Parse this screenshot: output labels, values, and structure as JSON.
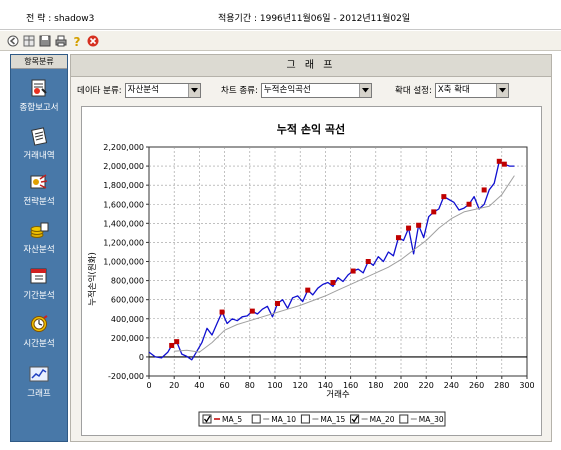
{
  "header": {
    "strategy": "전 략 : shadow3",
    "period": "적용기간 : 1996년11월06일 - 2012년11월02일"
  },
  "toolbar": {
    "buttons": [
      "back-icon",
      "grid-icon",
      "save-icon",
      "print-icon",
      "help-icon",
      "close-icon"
    ]
  },
  "sidebar": {
    "title": "항목분류",
    "items": [
      {
        "label": "종합보고서",
        "icon": "report-icon"
      },
      {
        "label": "거래내역",
        "icon": "trade-history-icon"
      },
      {
        "label": "전략분석",
        "icon": "strategy-analysis-icon"
      },
      {
        "label": "자산분석",
        "icon": "asset-analysis-icon"
      },
      {
        "label": "기간분석",
        "icon": "period-analysis-icon"
      },
      {
        "label": "시간분석",
        "icon": "time-analysis-icon"
      },
      {
        "label": "그래프",
        "icon": "graph-icon"
      }
    ]
  },
  "main": {
    "title": "그 래 프",
    "filters": {
      "data_label": "데이타 분류:",
      "data_value": "자산분석",
      "chart_label": "차트 종류:",
      "chart_value": "누적손익곡선",
      "zoom_label": "확대 설정:",
      "zoom_value": "X축 확대"
    }
  },
  "colors": {
    "equity_line": "#1010d0",
    "ma_line": "#a0a0a0",
    "marker": "#c00000",
    "title": "#1a1aa0",
    "sidebar": "#4878a8"
  },
  "chart_data": {
    "type": "line",
    "title": "누적 손익 곡선",
    "xlabel": "거래수",
    "ylabel": "누적손익(원화)",
    "xlim": [
      0,
      300
    ],
    "ylim": [
      -200000,
      2200000
    ],
    "xticks": [
      0,
      20,
      40,
      60,
      80,
      100,
      120,
      140,
      160,
      180,
      200,
      220,
      240,
      260,
      280,
      300
    ],
    "yticks": [
      "-200,000",
      "0",
      "200,000",
      "400,000",
      "600,000",
      "800,000",
      "1,000,000",
      "1,200,000",
      "1,400,000",
      "1,600,000",
      "1,800,000",
      "2,000,000",
      "2,200,000"
    ],
    "grid": true,
    "series": [
      {
        "name": "누적손익",
        "x": [
          0,
          5,
          10,
          15,
          18,
          22,
          26,
          30,
          34,
          38,
          42,
          46,
          50,
          54,
          58,
          62,
          66,
          70,
          74,
          78,
          82,
          86,
          90,
          94,
          98,
          102,
          106,
          110,
          114,
          118,
          122,
          126,
          130,
          134,
          138,
          142,
          146,
          150,
          154,
          158,
          162,
          166,
          170,
          174,
          178,
          182,
          186,
          190,
          194,
          198,
          202,
          206,
          210,
          214,
          218,
          222,
          226,
          230,
          234,
          238,
          242,
          246,
          250,
          254,
          258,
          262,
          266,
          270,
          274,
          278,
          282,
          286,
          290
        ],
        "y": [
          50000,
          0,
          -10000,
          50000,
          120000,
          160000,
          30000,
          5000,
          -30000,
          60000,
          150000,
          300000,
          230000,
          350000,
          470000,
          350000,
          400000,
          380000,
          420000,
          430000,
          480000,
          450000,
          500000,
          530000,
          420000,
          560000,
          600000,
          510000,
          620000,
          640000,
          580000,
          700000,
          650000,
          720000,
          760000,
          780000,
          740000,
          830000,
          790000,
          860000,
          900000,
          920000,
          880000,
          1000000,
          960000,
          1050000,
          1000000,
          1100000,
          1060000,
          1250000,
          1220000,
          1350000,
          1080000,
          1380000,
          1250000,
          1470000,
          1520000,
          1550000,
          1680000,
          1650000,
          1620000,
          1540000,
          1560000,
          1600000,
          1680000,
          1550000,
          1600000,
          1750000,
          1820000,
          2050000,
          2020000,
          2000000,
          2000000
        ]
      },
      {
        "name": "MA_20",
        "x": [
          20,
          30,
          40,
          50,
          60,
          70,
          80,
          90,
          100,
          110,
          120,
          130,
          140,
          150,
          160,
          170,
          180,
          190,
          200,
          210,
          220,
          230,
          240,
          250,
          260,
          270,
          280,
          290
        ],
        "y": [
          60000,
          70000,
          50000,
          150000,
          280000,
          340000,
          380000,
          420000,
          460000,
          500000,
          540000,
          590000,
          640000,
          700000,
          760000,
          820000,
          880000,
          940000,
          1020000,
          1120000,
          1220000,
          1350000,
          1450000,
          1520000,
          1550000,
          1580000,
          1700000,
          1900000
        ]
      }
    ],
    "markers": {
      "x": [
        18,
        22,
        58,
        82,
        102,
        126,
        146,
        162,
        174,
        198,
        206,
        214,
        226,
        234,
        254,
        266,
        278,
        282
      ],
      "y": [
        120000,
        160000,
        470000,
        480000,
        560000,
        700000,
        780000,
        900000,
        1000000,
        1250000,
        1350000,
        1380000,
        1520000,
        1680000,
        1600000,
        1750000,
        2050000,
        2020000
      ]
    },
    "legend": {
      "position": "bottom",
      "items": [
        {
          "label": "MA_5",
          "checked": true
        },
        {
          "label": "MA_10",
          "checked": false
        },
        {
          "label": "MA_15",
          "checked": false
        },
        {
          "label": "MA_20",
          "checked": true
        },
        {
          "label": "MA_30",
          "checked": false
        }
      ]
    }
  }
}
